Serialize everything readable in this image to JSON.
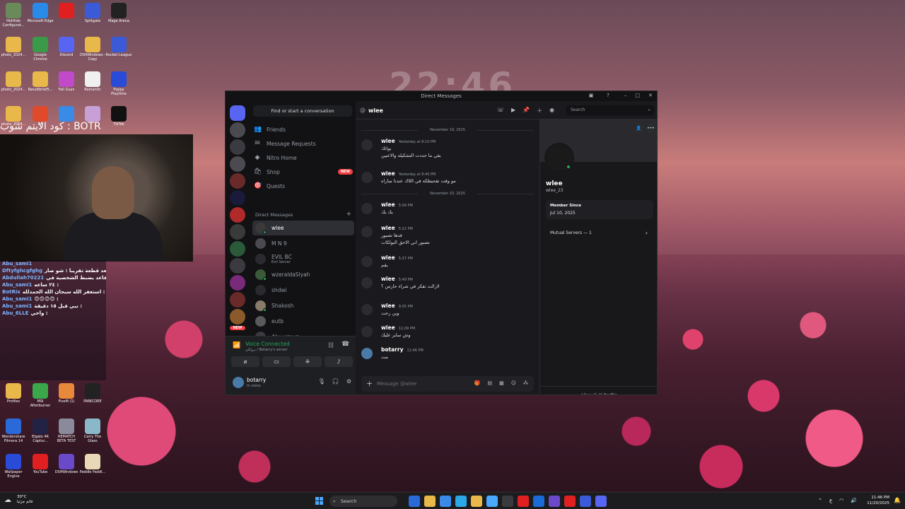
{
  "desktop": {
    "clock": "22:46",
    "stream_title": "كود الايتم شوب : BOTR",
    "icons": [
      {
        "label": "HidHide Configurat...",
        "color": "#6a8a5a"
      },
      {
        "label": "Microsoft Edge",
        "color": "#2a8ae8"
      },
      {
        "label": "",
        "color": "#e02020"
      },
      {
        "label": "Splitgate",
        "color": "#3a5ad8"
      },
      {
        "label": "Mage Arena",
        "color": "#222222"
      },
      {
        "label": "photo_2024...",
        "color": "#e8b84a"
      },
      {
        "label": "Google Chrome",
        "color": "#3a9a4a"
      },
      {
        "label": "Discord",
        "color": "#5865f2"
      },
      {
        "label": "DS4Windows - Copy",
        "color": "#e8b84a"
      },
      {
        "label": "Rocket League",
        "color": "#3a5ad8"
      },
      {
        "label": "photo_2024...",
        "color": "#e8b84a"
      },
      {
        "label": "Resultbrief5...",
        "color": "#e8b84a"
      },
      {
        "label": "Fall Guys",
        "color": "#c04ac8"
      },
      {
        "label": "Romantic",
        "color": "#f0f0f0"
      },
      {
        "label": "Poppy Playtime",
        "color": "#2a4ad8"
      },
      {
        "label": "photo_2024...",
        "color": "#e8b84a"
      },
      {
        "label": "EA",
        "color": "#e04a2a"
      },
      {
        "label": "",
        "color": "#3a8ae8"
      },
      {
        "label": "",
        "color": "#c8a0d8"
      },
      {
        "label": "TikTok",
        "color": "#111111"
      },
      {
        "label": "Profiles",
        "color": "#e8b84a"
      },
      {
        "label": "MSI Afterburner",
        "color": "#3aa84a"
      },
      {
        "label": "FiveM (1)",
        "color": "#e8883a"
      },
      {
        "label": "PANICORE",
        "color": "#222222"
      },
      {
        "label": "Wondershare Filmora 14",
        "color": "#2a6ad8"
      },
      {
        "label": "Elgato 4K Captur...",
        "color": "#222244"
      },
      {
        "label": "REMATCH BETA TEST",
        "color": "#8a8a9a"
      },
      {
        "label": "Carry The Glass",
        "color": "#8ab8c8"
      },
      {
        "label": "Wallpaper Engine",
        "color": "#2a4ad8"
      },
      {
        "label": "YouTube",
        "color": "#e02020"
      },
      {
        "label": "DS4Windows",
        "color": "#6a4ac8"
      },
      {
        "label": "Paddle Paddl...",
        "color": "#e8d8b8"
      }
    ]
  },
  "stream_chat": [
    {
      "name": "Abu_sami1",
      "text": ""
    },
    {
      "name": "Dftyfghcgfghg",
      "text": "سلام عليكم بعد قطعة تقريبا : شو صار"
    },
    {
      "name": "Abdullah70221",
      "text": "قاعد يضبط الشخصية في :"
    },
    {
      "name": "Abu_sami1",
      "text": "٢٤ ساعه :"
    },
    {
      "name": "BotRix",
      "text": "استغفر الله سبحان الله الحمدلله :"
    },
    {
      "name": "Abu_sami1",
      "text": "😊😊😊😊 :"
    },
    {
      "name": "Abu_sami1",
      "text": "نبي قبل ١٥ دقيقة :"
    },
    {
      "name": "Abu_6LLE",
      "text": "واحي :"
    }
  ],
  "discord": {
    "window_title": "Direct Messages",
    "find_placeholder": "Find or start a conversation",
    "nav": [
      {
        "icon": "friends-icon",
        "glyph": "👥",
        "label": "Friends"
      },
      {
        "icon": "message-requests-icon",
        "glyph": "✉",
        "label": "Message Requests"
      },
      {
        "icon": "nitro-icon",
        "glyph": "◆",
        "label": "Nitro Home"
      },
      {
        "icon": "shop-icon",
        "glyph": "🛍",
        "label": "Shop",
        "badge": "NEW"
      },
      {
        "icon": "quests-icon",
        "glyph": "🎯",
        "label": "Quests"
      }
    ],
    "dm_header": "Direct Messages",
    "dms": [
      {
        "name": "wlee",
        "sub": "",
        "color": "#3a3a3a",
        "active": true,
        "online": true
      },
      {
        "name": "M N 9",
        "sub": "",
        "color": "#4a4a50",
        "active": false,
        "online": false
      },
      {
        "name": "EVIL BC",
        "sub": "Evil Server",
        "color": "#2a2a30",
        "active": false,
        "online": false
      },
      {
        "name": "wzeraldaSlyah",
        "sub": "",
        "color": "#3a5a3a",
        "active": false,
        "online": true
      },
      {
        "name": "shdwi",
        "sub": "",
        "color": "#2a2a2e",
        "active": false,
        "online": false
      },
      {
        "name": "Shakosh",
        "sub": "",
        "color": "#8a7a6a",
        "active": false,
        "online": true
      },
      {
        "name": "eutb",
        "sub": "",
        "color": "#5a5a5e",
        "active": false,
        "online": false
      },
      {
        "name": "Abu azouz",
        "sub": "",
        "color": "#3a3a40",
        "active": false,
        "online": false
      }
    ],
    "voice": {
      "title": "Voice Connected",
      "sub": "بروكلي / Botarry's server"
    },
    "user": {
      "name": "botarry",
      "status": "In voice"
    },
    "chat": {
      "recipient": "wlee",
      "search_placeholder": "Search",
      "input_placeholder": "Message @wlee",
      "dividers": [
        "November 19, 2025",
        "November 20, 2025"
      ],
      "messages": [
        {
          "author": "wlee",
          "time": "Yesterday at 8:10 PM",
          "text": "يواثك",
          "text2": "بقي ما حددت التشكيله والاعبين"
        },
        {
          "author": "wlee",
          "time": "Yesterday at 8:40 PM",
          "text": "مو وقت تقحيطكه في اللاك عندنا مباراه"
        },
        {
          "author": "wlee",
          "time": "5:09 PM",
          "text": "يك يك"
        },
        {
          "author": "wlee",
          "time": "5:22 PM",
          "text": "قدها تصبور",
          "text2": "تصبور اني الاحق البولكات"
        },
        {
          "author": "wlee",
          "time": "5:37 PM",
          "text": "يقم"
        },
        {
          "author": "wlee",
          "time": "5:49 PM",
          "text": "لازالت تفكر في شراء حارس ؟"
        },
        {
          "author": "wlee",
          "time": "9:35 PM",
          "text": "وين رحت"
        },
        {
          "author": "wlee",
          "time": "11:09 PM",
          "text": "وش ساير عليك"
        },
        {
          "author": "botarry",
          "time": "11:46 PM",
          "text": "مت"
        }
      ]
    },
    "profile": {
      "name": "wlee",
      "handle": "wlee_23",
      "member_since_label": "Member Since",
      "member_since": "Jul 10, 2025",
      "mutual_servers": "Mutual Servers — 1",
      "view_full": "View Full Profile"
    }
  },
  "taskbar": {
    "weather_temp": "30°C",
    "weather_desc": "غائم جزئيا",
    "search": "Search",
    "time": "11:46 PM",
    "date": "11/20/2025"
  }
}
